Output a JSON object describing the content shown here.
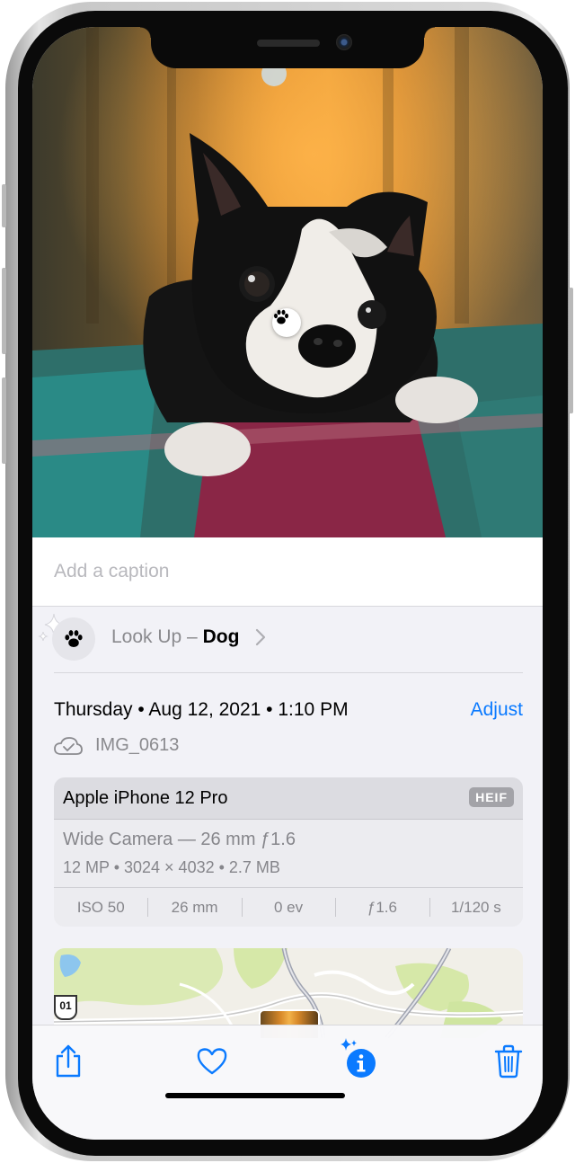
{
  "photo": {
    "subject_icon": "paw-icon"
  },
  "caption": {
    "placeholder": "Add a caption"
  },
  "lookup": {
    "prefix": "Look Up – ",
    "subject": "Dog",
    "icon": "paw-icon",
    "decoration": "sparkles-icon"
  },
  "details": {
    "date": "Thursday • Aug 12, 2021 • 1:10 PM",
    "adjust_label": "Adjust",
    "cloud_icon": "cloud-check-icon",
    "filename": "IMG_0613"
  },
  "camera": {
    "device": "Apple iPhone 12 Pro",
    "format": "HEIF",
    "lens": "Wide Camera — 26 mm ƒ1.6",
    "specs": "12 MP  •  3024 × 4032  •  2.7 MB",
    "exif": [
      "ISO 50",
      "26 mm",
      "0 ev",
      "ƒ1.6",
      "1/120 s"
    ]
  },
  "map": {
    "route_label": "01"
  },
  "toolbar": {
    "items": [
      "share-icon",
      "heart-icon",
      "info-sparkle-icon",
      "trash-icon"
    ]
  },
  "colors": {
    "accent": "#0a7aff",
    "background": "#f2f2f7",
    "secondary_text": "#8a8a8e"
  }
}
